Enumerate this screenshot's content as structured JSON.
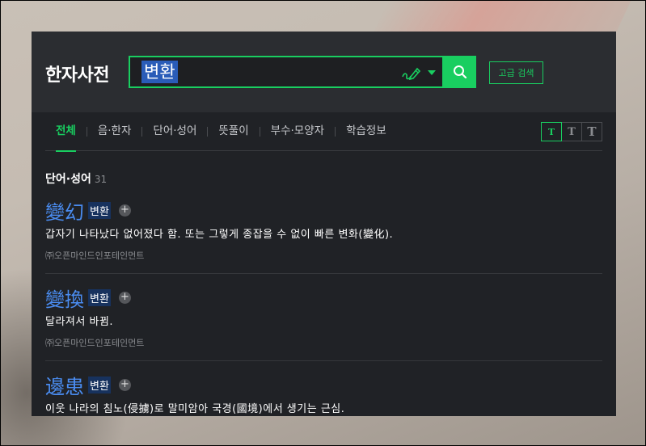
{
  "header": {
    "title": "한자사전",
    "search_value": "변환",
    "advanced_label": "고급 검색"
  },
  "tabs": [
    {
      "label": "전체",
      "active": true
    },
    {
      "label": "음·한자"
    },
    {
      "label": "단어·성어"
    },
    {
      "label": "뜻풀이"
    },
    {
      "label": "부수·모양자"
    },
    {
      "label": "학습정보"
    }
  ],
  "font_size_buttons": [
    "T",
    "T",
    "T"
  ],
  "section": {
    "heading": "단어·성어",
    "count": "31"
  },
  "entries": [
    {
      "hanja": "變幻",
      "reading": "변환",
      "plus": "+",
      "definition": "갑자기 나타났다 없어졌다 함. 또는 그렇게 종잡을 수 없이 빠른 변화(變化).",
      "source": "㈜오픈마인드인포테인먼트"
    },
    {
      "hanja": "變換",
      "reading": "변환",
      "plus": "+",
      "definition": "달라져서 바뀜.",
      "source": "㈜오픈마인드인포테인먼트"
    },
    {
      "hanja": "邊患",
      "reading": "변환",
      "plus": "+",
      "definition": "이웃 나라의 침노(侵擄)로 말미암아 국경(國境)에서 생기는 근심.",
      "source": ""
    }
  ],
  "colors": {
    "accent": "#19ce60",
    "hanja": "#4a8cf0",
    "background": "#202226",
    "header": "#2b2d31"
  },
  "icons": {
    "handwrite": "handwriting-pen-icon",
    "dropdown": "chevron-down-icon",
    "search": "search-icon",
    "plus": "plus-icon"
  }
}
